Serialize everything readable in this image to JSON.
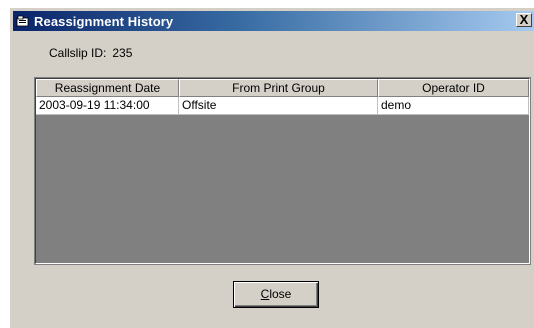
{
  "window": {
    "title": "Reassignment History",
    "close_glyph": "X",
    "icon": "folder-icon"
  },
  "callslip": {
    "label": "Callslip ID:",
    "value": "235"
  },
  "table": {
    "columns": [
      "Reassignment Date",
      "From Print Group",
      "Operator ID"
    ],
    "rows": [
      [
        "2003-09-19 11:34:00",
        "Offsite",
        "demo"
      ]
    ]
  },
  "close_button": {
    "mnemonic": "C",
    "rest": "lose"
  },
  "colors": {
    "title_start": "#0a246a",
    "title_end": "#a6caf0",
    "face": "#d4d0c8",
    "grid_empty": "#808080"
  }
}
